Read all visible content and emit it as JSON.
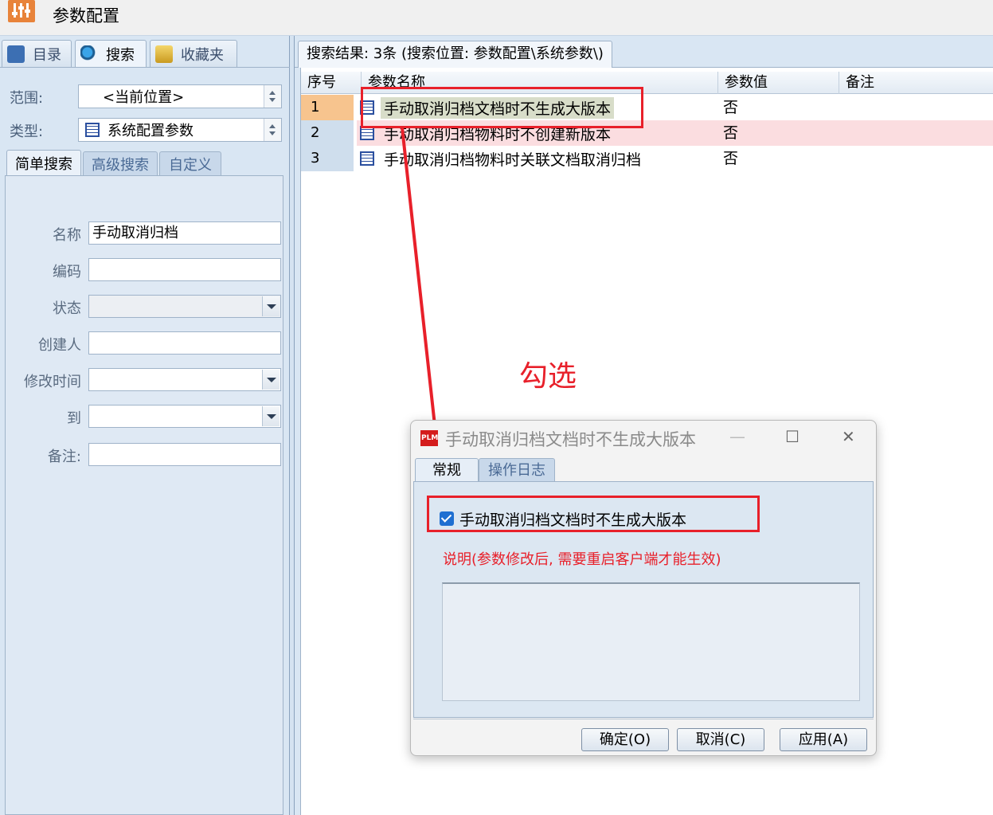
{
  "window": {
    "title": "参数配置",
    "icon": "sliders-icon"
  },
  "left_tabs": [
    {
      "label": "目录",
      "icon": "catalog-icon"
    },
    {
      "label": "搜索",
      "icon": "search-icon"
    },
    {
      "label": "收藏夹",
      "icon": "favorites-icon"
    }
  ],
  "filters": {
    "scope_label": "范围:",
    "scope_value": "<当前位置>",
    "type_label": "类型:",
    "type_value": "系统配置参数"
  },
  "search_tabs": [
    "简单搜索",
    "高级搜索",
    "自定义"
  ],
  "form": {
    "name_label": "名称",
    "name_value": "手动取消归档",
    "code_label": "编码",
    "code_value": "",
    "status_label": "状态",
    "status_value": "",
    "creator_label": "创建人",
    "creator_value": "",
    "modified_label": "修改时间",
    "modified_value": "",
    "to_label": "到",
    "to_value": "",
    "remark_label": "备注:",
    "remark_value": ""
  },
  "results": {
    "tab_label": "搜索结果: 3条 (搜索位置: 参数配置\\系统参数\\)",
    "columns": [
      "序号",
      "参数名称",
      "参数值",
      "备注"
    ],
    "rows": [
      {
        "no": "1",
        "name": "手动取消归档文档时不生成大版本",
        "value": "否",
        "remark": ""
      },
      {
        "no": "2",
        "name": "手动取消归档物料时不创建新版本",
        "value": "否",
        "remark": ""
      },
      {
        "no": "3",
        "name": "手动取消归档物料时关联文档取消归档",
        "value": "否",
        "remark": ""
      }
    ]
  },
  "annotation": {
    "text": "勾选",
    "color": "#e8202a"
  },
  "dialog": {
    "icon_text": "PLM",
    "title": "手动取消归档文档时不生成大版本",
    "minimize": "—",
    "maximize": "☐",
    "close": "✕",
    "tabs": [
      "常规",
      "操作日志"
    ],
    "checkbox_label": "手动取消归档文档时不生成大版本",
    "checkbox_checked": true,
    "note": "说明(参数修改后, 需要重启客户端才能生效)",
    "buttons": [
      "确定(O)",
      "取消(C)",
      "应用(A)"
    ]
  },
  "colors": {
    "selected_row": "#f7c48e",
    "selected_name_bg": "#d8ddc9",
    "row2_bg": "#fbdde0",
    "accent_red": "#e8202a"
  }
}
